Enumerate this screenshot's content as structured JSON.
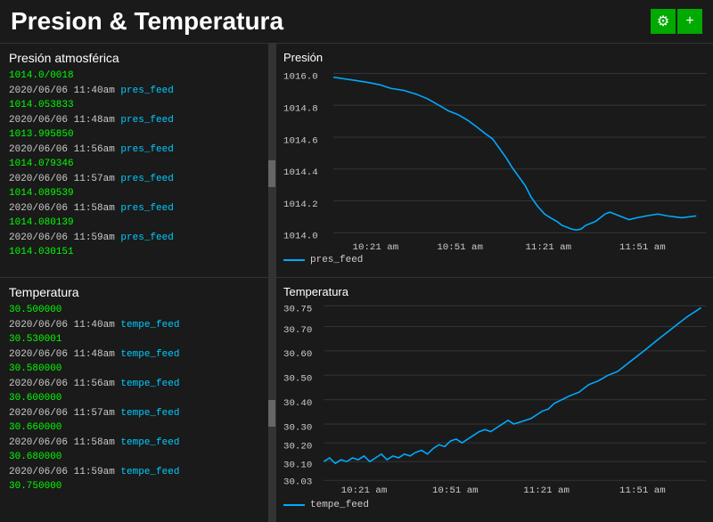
{
  "header": {
    "title": "Presion & Temperatura",
    "gear_button": "⚙",
    "plus_button": "+"
  },
  "pressure_list": {
    "title": "Presión atmosférica",
    "entries": [
      {
        "date": "2020/06/06",
        "time": "11:40am",
        "feed": "pres_feed",
        "value": "1014.053833"
      },
      {
        "date": "2020/06/06",
        "time": "11:48am",
        "feed": "pres_feed",
        "value": "1013.995850"
      },
      {
        "date": "2020/06/06",
        "time": "11:56am",
        "feed": "pres_feed",
        "value": "1014.079346"
      },
      {
        "date": "2020/06/06",
        "time": "11:57am",
        "feed": "pres_feed",
        "value": "1014.089539"
      },
      {
        "date": "2020/06/06",
        "time": "11:58am",
        "feed": "pres_feed",
        "value": "1014.080139"
      },
      {
        "date": "2020/06/06",
        "time": "11:59am",
        "feed": "pres_feed",
        "value": "1014.030151"
      }
    ],
    "first_value": "1014.0/0018"
  },
  "temperature_list": {
    "title": "Temperatura",
    "entries": [
      {
        "date": "2020/06/06",
        "time": "11:40am",
        "feed": "tempe_feed",
        "value": "30.530001"
      },
      {
        "date": "2020/06/06",
        "time": "11:48am",
        "feed": "tempe_feed",
        "value": "30.580000"
      },
      {
        "date": "2020/06/06",
        "time": "11:56am",
        "feed": "tempe_feed",
        "value": "30.600000"
      },
      {
        "date": "2020/06/06",
        "time": "11:57am",
        "feed": "tempe_feed",
        "value": "30.660000"
      },
      {
        "date": "2020/06/06",
        "time": "11:58am",
        "feed": "tempe_feed",
        "value": "30.680000"
      },
      {
        "date": "2020/06/06",
        "time": "11:59am",
        "feed": "tempe_feed",
        "value": "30.750000"
      }
    ],
    "first_value": "30.500000"
  },
  "pressure_chart": {
    "title": "Presión",
    "y_labels": [
      "1016.0",
      "1014.8",
      "1014.6",
      "1014.4",
      "1014.2",
      "1014.0"
    ],
    "x_labels": [
      "10:21 am",
      "10:51 am",
      "11:21 am",
      "11:51 am"
    ],
    "legend": "pres_feed"
  },
  "temperature_chart": {
    "title": "Temperatura",
    "y_labels": [
      "30.75",
      "30.70",
      "30.60",
      "30.50",
      "30.40",
      "30.30",
      "30.20",
      "30.10",
      "30.03"
    ],
    "x_labels": [
      "10:21 am",
      "10:51 am",
      "11:21 am",
      "11:51 am"
    ],
    "legend": "tempe_feed"
  }
}
